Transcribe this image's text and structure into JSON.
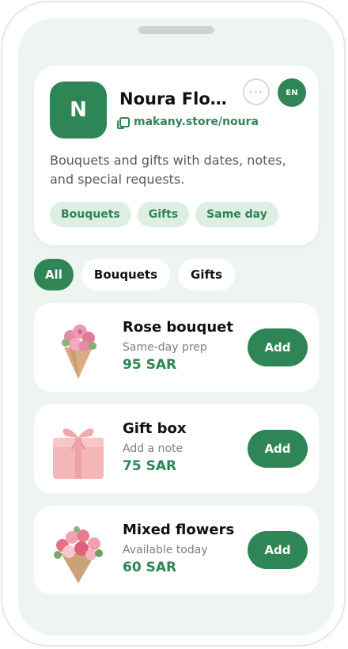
{
  "store": {
    "logo_letter": "N",
    "name": "Noura Flow...",
    "link": "makany.store/noura",
    "more_label": "···",
    "lang_label": "EN",
    "description": "Bouquets and gifts with dates, notes, and special requests.",
    "tags": [
      "Bouquets",
      "Gifts",
      "Same day"
    ]
  },
  "filters": [
    {
      "label": "All",
      "active": true
    },
    {
      "label": "Bouquets",
      "active": false
    },
    {
      "label": "Gifts",
      "active": false
    }
  ],
  "products": [
    {
      "name": "Rose bouquet",
      "subtitle": "Same-day prep",
      "price": "95 SAR",
      "add_label": "Add",
      "image": "rose-bouquet-image"
    },
    {
      "name": "Gift box",
      "subtitle": "Add a note",
      "price": "75 SAR",
      "add_label": "Add",
      "image": "gift-box-image"
    },
    {
      "name": "Mixed flowers",
      "subtitle": "Available today",
      "price": "60 SAR",
      "add_label": "Add",
      "image": "mixed-flowers-image"
    }
  ],
  "colors": {
    "accent": "#2e8556",
    "chip_bg": "#dcefe2",
    "screen_bg": "#eef5f0"
  }
}
